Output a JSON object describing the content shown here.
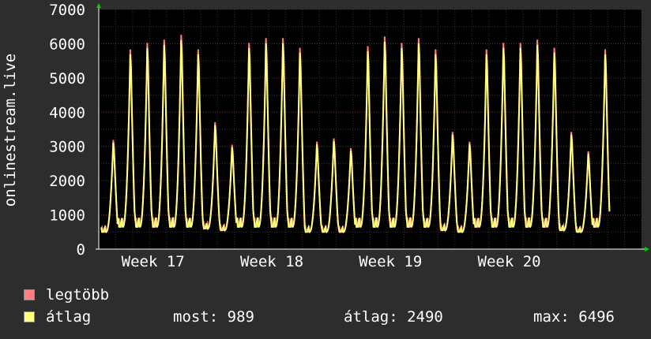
{
  "chart_data": {
    "type": "line",
    "ylabel": "onlinestream.live",
    "ylim": [
      0,
      7000
    ],
    "y_ticks": [
      "0",
      "1000",
      "2000",
      "3000",
      "4000",
      "5000",
      "6000",
      "7000"
    ],
    "x_ticks": [
      "Week 17",
      "Week 18",
      "Week 19",
      "Week 20"
    ],
    "grid": true,
    "legend_placement": "bottom",
    "days": 32,
    "daily_peaks": [
      3350,
      6150,
      6350,
      6450,
      6600,
      6150,
      3900,
      3200,
      6350,
      6500,
      6500,
      6200,
      3300,
      3400,
      3100,
      6250,
      6550,
      6350,
      6500,
      6150,
      3600,
      3300,
      6150,
      6350,
      6350,
      6450,
      6200,
      3600,
      3000,
      6150
    ],
    "daily_troughs": [
      500,
      650,
      650,
      650,
      650,
      650,
      600,
      550,
      650,
      650,
      650,
      650,
      500,
      500,
      500,
      650,
      650,
      650,
      650,
      650,
      550,
      500,
      650,
      650,
      650,
      650,
      650,
      550,
      500,
      650
    ],
    "series": [
      {
        "name": "legtöbb",
        "color": "#ff7f7f"
      },
      {
        "name": "átlag",
        "color": "#ffff7f"
      }
    ]
  },
  "legend": {
    "max_label": "legtöbb",
    "avg_label": "átlag",
    "stat_now": "most: 989",
    "stat_avg": "átlag: 2490",
    "stat_max": "max: 6496"
  },
  "colors": {
    "background": "#2d2d2d",
    "plot_background": "#000000",
    "grid": "#444444",
    "axis": "#ffffff",
    "arrow": "#00cc00"
  }
}
